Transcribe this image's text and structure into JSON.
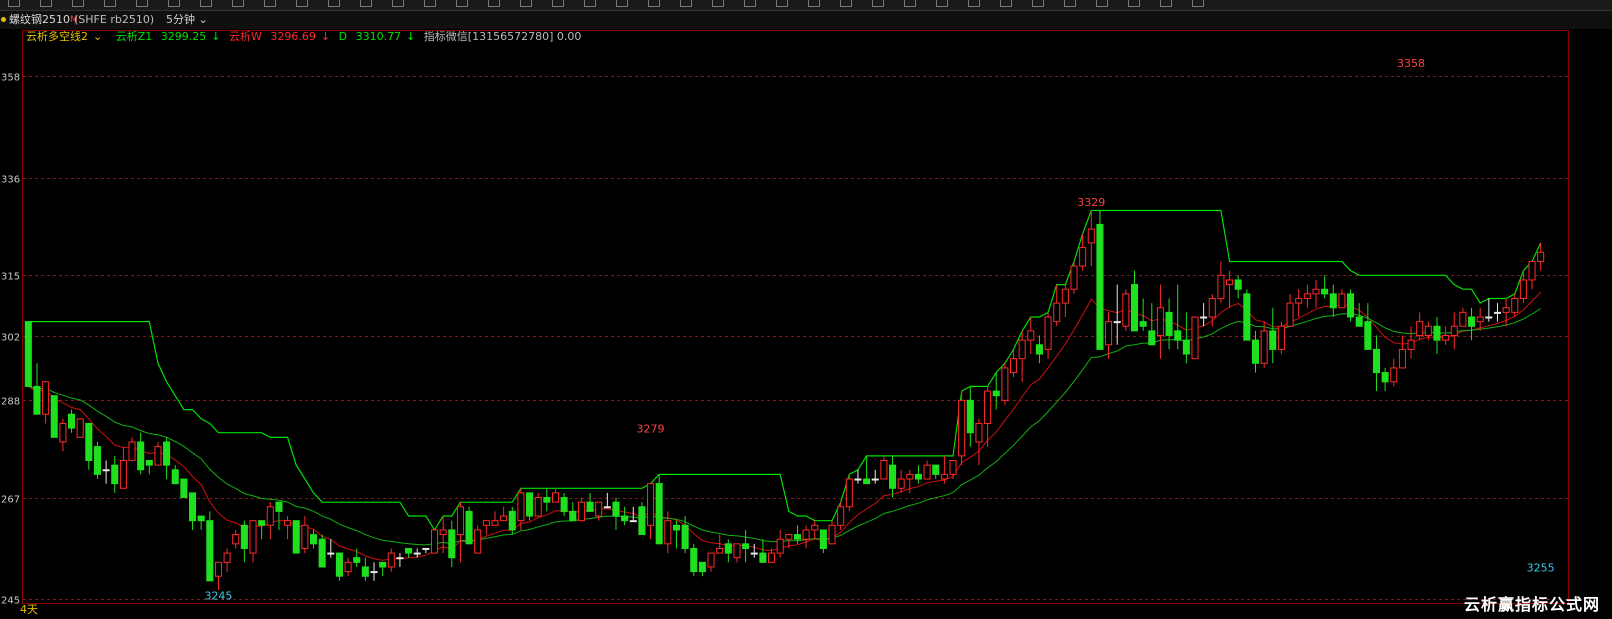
{
  "window": {
    "symbol": "螺纹钢2510",
    "symbol_flag": "M",
    "exchange": "(SHFE rb2510)",
    "period": "5分钟",
    "period_arrow": "chevron-down-icon"
  },
  "legend": {
    "indicator": "云析多空线2",
    "indicator_arrow": "chevron-down-icon",
    "z1_label": "云析Z1",
    "z1_value": "3299.25",
    "w_label": "云析W",
    "w_value": "3296.69",
    "d_label": "D",
    "d_value": "3310.77",
    "contact": "指标微信[13156572780] 0.00",
    "colors": {
      "indicator": "#e6c000",
      "z1": "#00e000",
      "w": "#ff2a2a",
      "d": "#00e000",
      "contact": "#bbbbbb"
    }
  },
  "footer": {
    "range": "4天",
    "watermark": "云析赢指标公式网"
  },
  "chart_data": {
    "type": "candlestick",
    "y_ticks": [
      {
        "label": "358",
        "value": 3358
      },
      {
        "label": "336",
        "value": 3336
      },
      {
        "label": "315",
        "value": 3315
      },
      {
        "label": "302",
        "value": 3302
      },
      {
        "label": "288",
        "value": 3288
      },
      {
        "label": "267",
        "value": 3267
      },
      {
        "label": "245",
        "value": 3245
      }
    ],
    "ylim": [
      3244,
      3368
    ],
    "bar_count": 176,
    "candles": [
      [
        0,
        3305,
        3305,
        3291,
        3291
      ],
      [
        1,
        3291,
        3296,
        3285,
        3285
      ],
      [
        2,
        3285,
        3292,
        3283,
        3292
      ],
      [
        3,
        3289,
        3289,
        3280,
        3280
      ],
      [
        4,
        3279,
        3284,
        3277,
        3283
      ],
      [
        5,
        3285,
        3286,
        3281,
        3282
      ],
      [
        6,
        3280,
        3284,
        3280,
        3284
      ],
      [
        7,
        3283,
        3283,
        3273,
        3275
      ],
      [
        8,
        3278,
        3279,
        3271,
        3272
      ],
      [
        9,
        3273,
        3275,
        3270,
        3273
      ],
      [
        10,
        3274,
        3276,
        3268,
        3270
      ],
      [
        11,
        3269,
        3278,
        3269,
        3275
      ],
      [
        12,
        3275,
        3280,
        3275,
        3279
      ],
      [
        13,
        3279,
        3281,
        3272,
        3273
      ],
      [
        14,
        3275,
        3275,
        3272,
        3274
      ],
      [
        15,
        3274,
        3279,
        3274,
        3278
      ],
      [
        16,
        3279,
        3280,
        3271,
        3274
      ],
      [
        17,
        3273,
        3274,
        3270,
        3270
      ],
      [
        18,
        3271,
        3271,
        3267,
        3267
      ],
      [
        19,
        3268,
        3268,
        3260,
        3262
      ],
      [
        20,
        3263,
        3263,
        3260,
        3262
      ],
      [
        21,
        3262,
        3264,
        3249,
        3249
      ],
      [
        22,
        3250,
        3253,
        3247,
        3253
      ],
      [
        23,
        3253,
        3256,
        3251,
        3255
      ],
      [
        24,
        3257,
        3260,
        3256,
        3259
      ],
      [
        25,
        3261,
        3262,
        3253,
        3256
      ],
      [
        26,
        3255,
        3262,
        3253,
        3262
      ],
      [
        27,
        3262,
        3262,
        3258,
        3261
      ],
      [
        28,
        3261,
        3266,
        3258,
        3265
      ],
      [
        29,
        3266,
        3266,
        3260,
        3264
      ],
      [
        30,
        3261,
        3263,
        3258,
        3262
      ],
      [
        31,
        3262,
        3262,
        3255,
        3255
      ],
      [
        32,
        3256,
        3263,
        3255,
        3261
      ],
      [
        33,
        3259,
        3260,
        3256,
        3257
      ],
      [
        34,
        3258,
        3259,
        3252,
        3252
      ],
      [
        35,
        3255,
        3258,
        3254,
        3255
      ],
      [
        36,
        3255,
        3255,
        3249,
        3250
      ],
      [
        37,
        3251,
        3254,
        3250,
        3253
      ],
      [
        38,
        3254,
        3256,
        3252,
        3253
      ],
      [
        39,
        3252,
        3254,
        3249,
        3250
      ],
      [
        40,
        3251,
        3253,
        3249,
        3251
      ],
      [
        41,
        3253,
        3253,
        3250,
        3252
      ],
      [
        42,
        3252,
        3256,
        3251,
        3255
      ],
      [
        43,
        3254,
        3255,
        3252,
        3254
      ],
      [
        44,
        3256,
        3256,
        3254,
        3255
      ],
      [
        45,
        3255,
        3256,
        3254,
        3255
      ],
      [
        46,
        3256,
        3256,
        3255,
        3256
      ],
      [
        47,
        3255,
        3260,
        3255,
        3260
      ],
      [
        48,
        3259,
        3263,
        3255,
        3260
      ],
      [
        49,
        3260,
        3262,
        3252,
        3254
      ],
      [
        50,
        3259,
        3266,
        3253,
        3265
      ],
      [
        51,
        3264,
        3265,
        3257,
        3257
      ],
      [
        52,
        3255,
        3261,
        3255,
        3260
      ],
      [
        53,
        3261,
        3262,
        3259,
        3262
      ],
      [
        54,
        3261,
        3264,
        3261,
        3262
      ],
      [
        55,
        3262,
        3265,
        3262,
        3263
      ],
      [
        56,
        3264,
        3265,
        3259,
        3260
      ],
      [
        57,
        3262,
        3269,
        3260,
        3268
      ],
      [
        58,
        3268,
        3268,
        3262,
        3263
      ],
      [
        59,
        3263,
        3268,
        3263,
        3267
      ],
      [
        60,
        3267,
        3269,
        3264,
        3266
      ],
      [
        61,
        3266,
        3269,
        3266,
        3268
      ],
      [
        62,
        3267,
        3268,
        3263,
        3264
      ],
      [
        63,
        3264,
        3266,
        3262,
        3262
      ],
      [
        64,
        3262,
        3267,
        3262,
        3266
      ],
      [
        65,
        3266,
        3268,
        3264,
        3264
      ],
      [
        66,
        3263,
        3266,
        3262,
        3266
      ],
      [
        67,
        3265,
        3268,
        3265,
        3265
      ],
      [
        68,
        3266,
        3267,
        3260,
        3263
      ],
      [
        69,
        3263,
        3265,
        3261,
        3262
      ],
      [
        70,
        3262,
        3265,
        3262,
        3262
      ],
      [
        71,
        3265,
        3266,
        3259,
        3259
      ],
      [
        72,
        3261,
        3270,
        3258,
        3270
      ],
      [
        73,
        3270,
        3272,
        3258,
        3257
      ],
      [
        74,
        3257,
        3264,
        3255,
        3262
      ],
      [
        75,
        3261,
        3262,
        3256,
        3260
      ],
      [
        76,
        3261,
        3263,
        3255,
        3256
      ],
      [
        77,
        3256,
        3257,
        3250,
        3251
      ],
      [
        78,
        3253,
        3253,
        3250,
        3251
      ],
      [
        79,
        3252,
        3255,
        3251,
        3255
      ],
      [
        80,
        3255,
        3259,
        3255,
        3256
      ],
      [
        81,
        3257,
        3258,
        3253,
        3255
      ],
      [
        82,
        3254,
        3257,
        3253,
        3257
      ],
      [
        83,
        3257,
        3260,
        3253,
        3256
      ],
      [
        84,
        3255,
        3257,
        3254,
        3255
      ],
      [
        85,
        3255,
        3258,
        3253,
        3253
      ],
      [
        86,
        3253,
        3256,
        3253,
        3255
      ],
      [
        87,
        3255,
        3260,
        3254,
        3258
      ],
      [
        88,
        3258,
        3259,
        3256,
        3259
      ],
      [
        89,
        3259,
        3261,
        3257,
        3258
      ],
      [
        90,
        3258,
        3261,
        3256,
        3260
      ],
      [
        91,
        3260,
        3262,
        3258,
        3261
      ],
      [
        92,
        3260,
        3260,
        3255,
        3256
      ],
      [
        93,
        3257,
        3262,
        3257,
        3261
      ],
      [
        94,
        3261,
        3266,
        3260,
        3265
      ],
      [
        95,
        3265,
        3272,
        3264,
        3271
      ],
      [
        96,
        3271,
        3273,
        3270,
        3271
      ],
      [
        97,
        3271,
        3276,
        3270,
        3270
      ],
      [
        98,
        3271,
        3273,
        3270,
        3271
      ],
      [
        99,
        3271,
        3276,
        3271,
        3275
      ],
      [
        100,
        3274,
        3276,
        3267,
        3269
      ],
      [
        101,
        3269,
        3273,
        3268,
        3271
      ],
      [
        102,
        3271,
        3273,
        3268,
        3272
      ],
      [
        103,
        3272,
        3274,
        3270,
        3271
      ],
      [
        104,
        3271,
        3275,
        3271,
        3274
      ],
      [
        105,
        3274,
        3274,
        3271,
        3272
      ],
      [
        106,
        3271,
        3276,
        3270,
        3272
      ],
      [
        107,
        3272,
        3275,
        3271,
        3275
      ],
      [
        108,
        3276,
        3290,
        3274,
        3288
      ],
      [
        109,
        3288,
        3291,
        3278,
        3281
      ],
      [
        110,
        3279,
        3284,
        3274,
        3283
      ],
      [
        111,
        3283,
        3291,
        3278,
        3290
      ],
      [
        112,
        3290,
        3294,
        3286,
        3289
      ],
      [
        113,
        3288,
        3296,
        3287,
        3295
      ],
      [
        114,
        3294,
        3299,
        3293,
        3297
      ],
      [
        115,
        3297,
        3303,
        3292,
        3301
      ],
      [
        116,
        3301,
        3306,
        3298,
        3303
      ],
      [
        117,
        3300,
        3302,
        3296,
        3298
      ],
      [
        118,
        3299,
        3307,
        3297,
        3306
      ],
      [
        119,
        3305,
        3313,
        3304,
        3309
      ],
      [
        120,
        3309,
        3313,
        3306,
        3312
      ],
      [
        121,
        3312,
        3318,
        3311,
        3317
      ],
      [
        122,
        3317,
        3324,
        3316,
        3321
      ],
      [
        123,
        3322,
        3329,
        3317,
        3325
      ],
      [
        124,
        3326,
        3329,
        3303,
        3299
      ],
      [
        125,
        3300,
        3307,
        3297,
        3305
      ],
      [
        126,
        3305,
        3313,
        3300,
        3305
      ],
      [
        127,
        3304,
        3312,
        3303,
        3311
      ],
      [
        128,
        3313,
        3316,
        3303,
        3303
      ],
      [
        129,
        3305,
        3310,
        3303,
        3304
      ],
      [
        130,
        3303,
        3309,
        3303,
        3300
      ],
      [
        131,
        3302,
        3313,
        3297,
        3308
      ],
      [
        132,
        3307,
        3310,
        3299,
        3302
      ],
      [
        133,
        3303,
        3313,
        3299,
        3301
      ],
      [
        134,
        3301,
        3307,
        3296,
        3298
      ],
      [
        135,
        3297,
        3306,
        3297,
        3306
      ],
      [
        136,
        3306,
        3309,
        3304,
        3306
      ],
      [
        137,
        3306,
        3311,
        3304,
        3310
      ],
      [
        138,
        3310,
        3318,
        3309,
        3315
      ],
      [
        139,
        3313,
        3316,
        3308,
        3314
      ],
      [
        140,
        3314,
        3315,
        3310,
        3312
      ],
      [
        141,
        3311,
        3312,
        3301,
        3301
      ],
      [
        142,
        3301,
        3303,
        3294,
        3296
      ],
      [
        143,
        3296,
        3305,
        3295,
        3303
      ],
      [
        144,
        3303,
        3308,
        3296,
        3299
      ],
      [
        145,
        3299,
        3305,
        3298,
        3304
      ],
      [
        146,
        3304,
        3311,
        3304,
        3309
      ],
      [
        147,
        3309,
        3312,
        3306,
        3310
      ],
      [
        148,
        3310,
        3313,
        3308,
        3311
      ],
      [
        149,
        3311,
        3314,
        3308,
        3312
      ],
      [
        150,
        3312,
        3315,
        3310,
        3311
      ],
      [
        151,
        3311,
        3313,
        3306,
        3308
      ],
      [
        152,
        3308,
        3312,
        3308,
        3311
      ],
      [
        153,
        3311,
        3312,
        3305,
        3306
      ],
      [
        154,
        3306,
        3309,
        3304,
        3304
      ],
      [
        155,
        3305,
        3309,
        3299,
        3299
      ],
      [
        156,
        3299,
        3302,
        3290,
        3294
      ],
      [
        157,
        3294,
        3295,
        3290,
        3292
      ],
      [
        158,
        3292,
        3297,
        3291,
        3295
      ],
      [
        159,
        3295,
        3302,
        3295,
        3299
      ],
      [
        160,
        3299,
        3304,
        3297,
        3301
      ],
      [
        161,
        3302,
        3307,
        3301,
        3305
      ],
      [
        162,
        3302,
        3305,
        3301,
        3304
      ],
      [
        163,
        3304,
        3306,
        3298,
        3301
      ],
      [
        164,
        3301,
        3304,
        3300,
        3302
      ],
      [
        165,
        3302,
        3307,
        3299,
        3304
      ],
      [
        166,
        3304,
        3308,
        3304,
        3307
      ],
      [
        167,
        3306,
        3308,
        3301,
        3304
      ],
      [
        168,
        3305,
        3308,
        3303,
        3306
      ],
      [
        169,
        3306,
        3310,
        3305,
        3306
      ],
      [
        170,
        3307,
        3309,
        3305,
        3307
      ],
      [
        171,
        3307,
        3310,
        3304,
        3308
      ],
      [
        172,
        3307,
        3311,
        3306,
        3310
      ],
      [
        173,
        3310,
        3316,
        3309,
        3314
      ],
      [
        174,
        3314,
        3318,
        3312,
        3318
      ],
      [
        175,
        3318,
        3322,
        3316,
        3320
      ]
    ],
    "series": [
      {
        "name": "云析Z1",
        "color": "#00e000"
      },
      {
        "name": "云析W",
        "color": "#ff2a2a"
      },
      {
        "name": "D",
        "color": "#00e000"
      }
    ],
    "annotations": [
      {
        "text": "3245",
        "bar": 22,
        "value": 3245,
        "color": "#3ec8e8"
      },
      {
        "text": "3279",
        "bar": 72,
        "value": 3281,
        "color": "#ff4040"
      },
      {
        "text": "3329",
        "bar": 123,
        "value": 3330,
        "color": "#ff4040"
      },
      {
        "text": "3358",
        "bar": 160,
        "value": 3360,
        "color": "#ff4040"
      },
      {
        "text": "3255",
        "bar": 175,
        "value": 3251,
        "color": "#3ec8e8"
      }
    ]
  }
}
